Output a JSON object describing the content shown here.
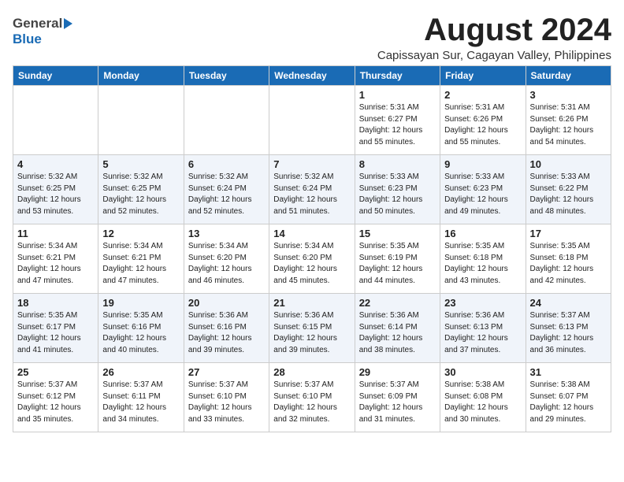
{
  "header": {
    "logo_general": "General",
    "logo_blue": "Blue",
    "title": "August 2024",
    "location": "Capissayan Sur, Cagayan Valley, Philippines"
  },
  "weekdays": [
    "Sunday",
    "Monday",
    "Tuesday",
    "Wednesday",
    "Thursday",
    "Friday",
    "Saturday"
  ],
  "weeks": [
    [
      {
        "day": "",
        "info": ""
      },
      {
        "day": "",
        "info": ""
      },
      {
        "day": "",
        "info": ""
      },
      {
        "day": "",
        "info": ""
      },
      {
        "day": "1",
        "info": "Sunrise: 5:31 AM\nSunset: 6:27 PM\nDaylight: 12 hours\nand 55 minutes."
      },
      {
        "day": "2",
        "info": "Sunrise: 5:31 AM\nSunset: 6:26 PM\nDaylight: 12 hours\nand 55 minutes."
      },
      {
        "day": "3",
        "info": "Sunrise: 5:31 AM\nSunset: 6:26 PM\nDaylight: 12 hours\nand 54 minutes."
      }
    ],
    [
      {
        "day": "4",
        "info": "Sunrise: 5:32 AM\nSunset: 6:25 PM\nDaylight: 12 hours\nand 53 minutes."
      },
      {
        "day": "5",
        "info": "Sunrise: 5:32 AM\nSunset: 6:25 PM\nDaylight: 12 hours\nand 52 minutes."
      },
      {
        "day": "6",
        "info": "Sunrise: 5:32 AM\nSunset: 6:24 PM\nDaylight: 12 hours\nand 52 minutes."
      },
      {
        "day": "7",
        "info": "Sunrise: 5:32 AM\nSunset: 6:24 PM\nDaylight: 12 hours\nand 51 minutes."
      },
      {
        "day": "8",
        "info": "Sunrise: 5:33 AM\nSunset: 6:23 PM\nDaylight: 12 hours\nand 50 minutes."
      },
      {
        "day": "9",
        "info": "Sunrise: 5:33 AM\nSunset: 6:23 PM\nDaylight: 12 hours\nand 49 minutes."
      },
      {
        "day": "10",
        "info": "Sunrise: 5:33 AM\nSunset: 6:22 PM\nDaylight: 12 hours\nand 48 minutes."
      }
    ],
    [
      {
        "day": "11",
        "info": "Sunrise: 5:34 AM\nSunset: 6:21 PM\nDaylight: 12 hours\nand 47 minutes."
      },
      {
        "day": "12",
        "info": "Sunrise: 5:34 AM\nSunset: 6:21 PM\nDaylight: 12 hours\nand 47 minutes."
      },
      {
        "day": "13",
        "info": "Sunrise: 5:34 AM\nSunset: 6:20 PM\nDaylight: 12 hours\nand 46 minutes."
      },
      {
        "day": "14",
        "info": "Sunrise: 5:34 AM\nSunset: 6:20 PM\nDaylight: 12 hours\nand 45 minutes."
      },
      {
        "day": "15",
        "info": "Sunrise: 5:35 AM\nSunset: 6:19 PM\nDaylight: 12 hours\nand 44 minutes."
      },
      {
        "day": "16",
        "info": "Sunrise: 5:35 AM\nSunset: 6:18 PM\nDaylight: 12 hours\nand 43 minutes."
      },
      {
        "day": "17",
        "info": "Sunrise: 5:35 AM\nSunset: 6:18 PM\nDaylight: 12 hours\nand 42 minutes."
      }
    ],
    [
      {
        "day": "18",
        "info": "Sunrise: 5:35 AM\nSunset: 6:17 PM\nDaylight: 12 hours\nand 41 minutes."
      },
      {
        "day": "19",
        "info": "Sunrise: 5:35 AM\nSunset: 6:16 PM\nDaylight: 12 hours\nand 40 minutes."
      },
      {
        "day": "20",
        "info": "Sunrise: 5:36 AM\nSunset: 6:16 PM\nDaylight: 12 hours\nand 39 minutes."
      },
      {
        "day": "21",
        "info": "Sunrise: 5:36 AM\nSunset: 6:15 PM\nDaylight: 12 hours\nand 39 minutes."
      },
      {
        "day": "22",
        "info": "Sunrise: 5:36 AM\nSunset: 6:14 PM\nDaylight: 12 hours\nand 38 minutes."
      },
      {
        "day": "23",
        "info": "Sunrise: 5:36 AM\nSunset: 6:13 PM\nDaylight: 12 hours\nand 37 minutes."
      },
      {
        "day": "24",
        "info": "Sunrise: 5:37 AM\nSunset: 6:13 PM\nDaylight: 12 hours\nand 36 minutes."
      }
    ],
    [
      {
        "day": "25",
        "info": "Sunrise: 5:37 AM\nSunset: 6:12 PM\nDaylight: 12 hours\nand 35 minutes."
      },
      {
        "day": "26",
        "info": "Sunrise: 5:37 AM\nSunset: 6:11 PM\nDaylight: 12 hours\nand 34 minutes."
      },
      {
        "day": "27",
        "info": "Sunrise: 5:37 AM\nSunset: 6:10 PM\nDaylight: 12 hours\nand 33 minutes."
      },
      {
        "day": "28",
        "info": "Sunrise: 5:37 AM\nSunset: 6:10 PM\nDaylight: 12 hours\nand 32 minutes."
      },
      {
        "day": "29",
        "info": "Sunrise: 5:37 AM\nSunset: 6:09 PM\nDaylight: 12 hours\nand 31 minutes."
      },
      {
        "day": "30",
        "info": "Sunrise: 5:38 AM\nSunset: 6:08 PM\nDaylight: 12 hours\nand 30 minutes."
      },
      {
        "day": "31",
        "info": "Sunrise: 5:38 AM\nSunset: 6:07 PM\nDaylight: 12 hours\nand 29 minutes."
      }
    ]
  ]
}
